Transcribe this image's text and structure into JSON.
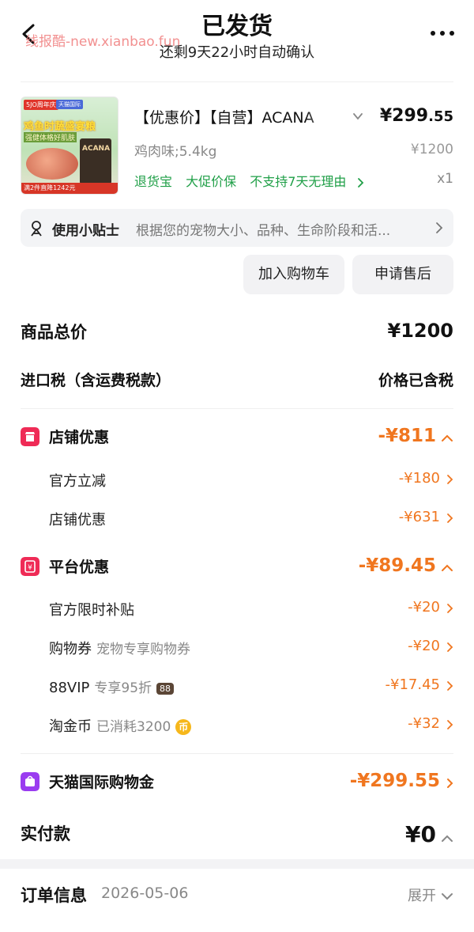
{
  "header": {
    "title": "已发货",
    "subtitle": "还剩9天22小时自动确认",
    "watermark": "线报酷-new.xianbao.fun"
  },
  "product": {
    "thumb": {
      "badge": "5JO周年庆",
      "tag": "天猫国际",
      "promo_line1": "鸡鱼时蔬盛宴粮",
      "promo_line2": "强健体格好肌肤",
      "brand_on_bag": "ACANA",
      "bottom_text": "满2件直降1242元"
    },
    "name": "【优惠价】【自营】ACANA",
    "price_main": "¥299",
    "price_decimal": ".55",
    "sku": "鸡肉味;5.4kg",
    "original_price": "¥1200",
    "services": [
      "退货宝",
      "大促价保",
      "不支持7天无理由"
    ],
    "quantity": "x1"
  },
  "tip": {
    "label": "使用小贴士",
    "text": "根据您的宠物大小、品种、生命阶段和活..."
  },
  "buttons": {
    "add_to_cart": "加入购物车",
    "after_sale": "申请售后"
  },
  "summary": {
    "total_label": "商品总价",
    "total_value": "¥1200",
    "tax_label": "进口税（含运费税款）",
    "tax_value": "价格已含税",
    "store_discount": {
      "label": "店铺优惠",
      "value": "-¥811",
      "color": "#ef2b56",
      "items": [
        {
          "label": "官方立减",
          "value": "-¥180"
        },
        {
          "label": "店铺优惠",
          "value": "-¥631"
        }
      ]
    },
    "platform_discount": {
      "label": "平台优惠",
      "value": "-¥89.45",
      "color": "#ef2b56",
      "items": [
        {
          "label": "官方限时补贴",
          "note": "",
          "value": "-¥20"
        },
        {
          "label": "购物券",
          "note": "宠物专享购物券",
          "value": "-¥20"
        },
        {
          "label": "88VIP",
          "note": "专享95折",
          "badge": "88",
          "value": "-¥17.45"
        },
        {
          "label": "淘金币",
          "note": "已消耗3200",
          "coin": "币",
          "value": "-¥32"
        }
      ]
    },
    "tmall_gold": {
      "label": "天猫国际购物金",
      "value": "-¥299.55",
      "color": "#9a3cf0"
    },
    "paid_label": "实付款",
    "paid_value": "¥0"
  },
  "order": {
    "label": "订单信息",
    "date": "2026-05-06",
    "expand": "展开"
  },
  "colors": {
    "accent_orange": "#f0761f",
    "service_green": "#1f9f47"
  }
}
